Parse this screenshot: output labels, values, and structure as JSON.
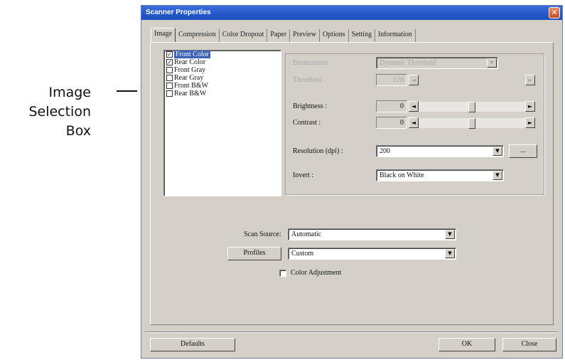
{
  "callout": {
    "line1": "Image",
    "line2": "Selection",
    "line3": "Box"
  },
  "window": {
    "title": "Scanner Properties",
    "close_glyph": "✕"
  },
  "tabs": [
    {
      "label": "Image",
      "active": true
    },
    {
      "label": "Compression",
      "active": false
    },
    {
      "label": "Color Dropout",
      "active": false
    },
    {
      "label": "Paper",
      "active": false
    },
    {
      "label": "Preview",
      "active": false
    },
    {
      "label": "Options",
      "active": false
    },
    {
      "label": "Setting",
      "active": false
    },
    {
      "label": "Information",
      "active": false
    }
  ],
  "image_list": [
    {
      "label": "Front Color",
      "checked": true,
      "selected": true
    },
    {
      "label": "Rear Color",
      "checked": true,
      "selected": false
    },
    {
      "label": "Front Gray",
      "checked": false,
      "selected": false
    },
    {
      "label": "Rear Gray",
      "checked": false,
      "selected": false
    },
    {
      "label": "Front B&W",
      "checked": false,
      "selected": false
    },
    {
      "label": "Rear B&W",
      "checked": false,
      "selected": false
    }
  ],
  "settings": {
    "binarization_label": "Binarization",
    "binarization_value": "Dynamic Threshold",
    "threshold_label": "Threshold :",
    "threshold_value": "128",
    "brightness_label": "Brightness :",
    "brightness_value": "0",
    "brightness_level": 0.5,
    "contrast_label": "Contrast  :",
    "contrast_value": "0",
    "contrast_level": 0.5,
    "resolution_label": "Resolution (dpi) :",
    "resolution_value": "200",
    "resolution_more_label": "...",
    "invert_label": "Invert :",
    "invert_value": "Black on White"
  },
  "scan": {
    "source_label": "Scan Source:",
    "source_value": "Automatic",
    "profiles_button": "Profiles",
    "profiles_value": "Custom",
    "color_adjustment_label": "Color Adjustment",
    "color_adjustment_checked": false
  },
  "footer": {
    "defaults_button": "Defaults",
    "ok_button": "OK",
    "close_button": "Close"
  },
  "icons": {
    "dropdown": "▼",
    "left": "◄",
    "right": "►",
    "check": "✓"
  }
}
